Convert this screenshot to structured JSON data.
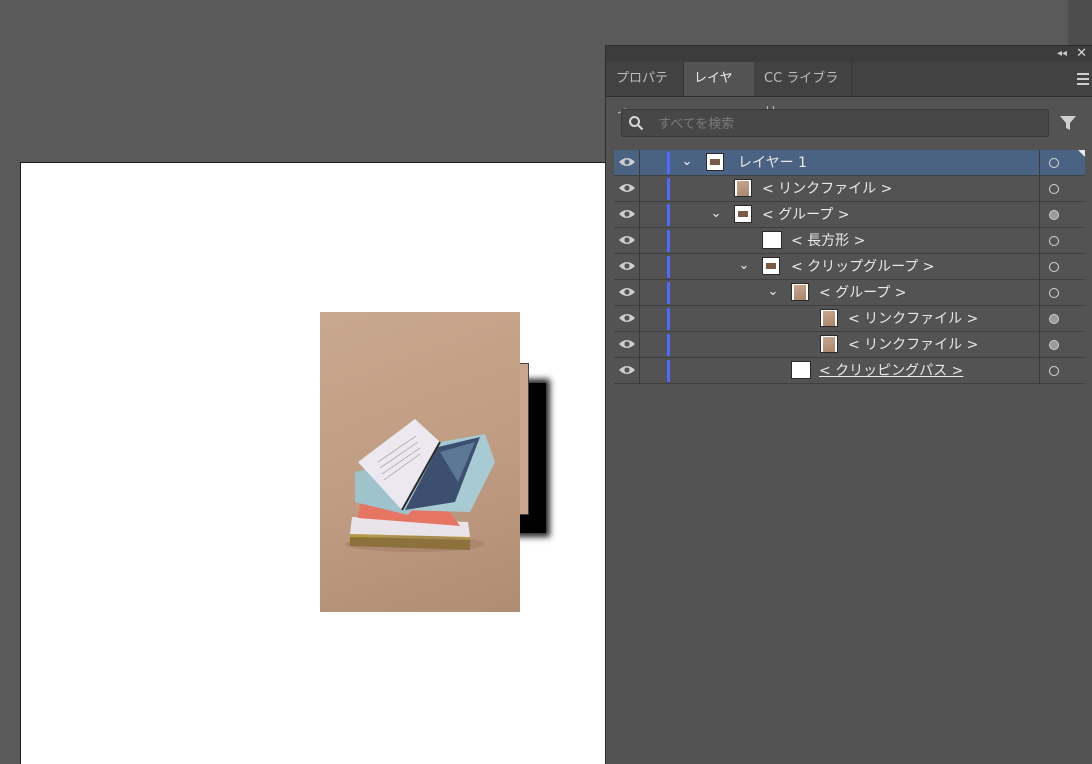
{
  "panel": {
    "collapse_glyph": "◂◂",
    "close_glyph": "✕",
    "tabs": [
      {
        "label": "プロパティ",
        "active": false
      },
      {
        "label": "レイヤー",
        "active": true
      },
      {
        "label": "CC ライブラリ",
        "active": false
      }
    ],
    "search": {
      "placeholder": "すべてを検索",
      "value": ""
    }
  },
  "layers": {
    "rows": [
      {
        "label": "レイヤー 1",
        "expanded": true,
        "selected": true,
        "target": "hollow"
      },
      {
        "label": "< リンクファイル >",
        "target": "hollow"
      },
      {
        "label": "< グループ >",
        "expanded": true,
        "target": "filled"
      },
      {
        "label": "< 長方形 >",
        "target": "hollow"
      },
      {
        "label": "< クリップグループ >",
        "expanded": true,
        "target": "hollow"
      },
      {
        "label": "< グループ >",
        "expanded": true,
        "target": "hollow"
      },
      {
        "label": "< リンクファイル >",
        "target": "filled"
      },
      {
        "label": "< リンクファイル >",
        "target": "filled"
      },
      {
        "label": "< クリッピングパス >",
        "target": "hollow",
        "underlined": true
      }
    ],
    "layer_color": "#4d6bff"
  },
  "colors": {
    "pasteboard": "#5a5a5a",
    "panel_bg": "#535353",
    "selected_row": "#4b6382"
  }
}
